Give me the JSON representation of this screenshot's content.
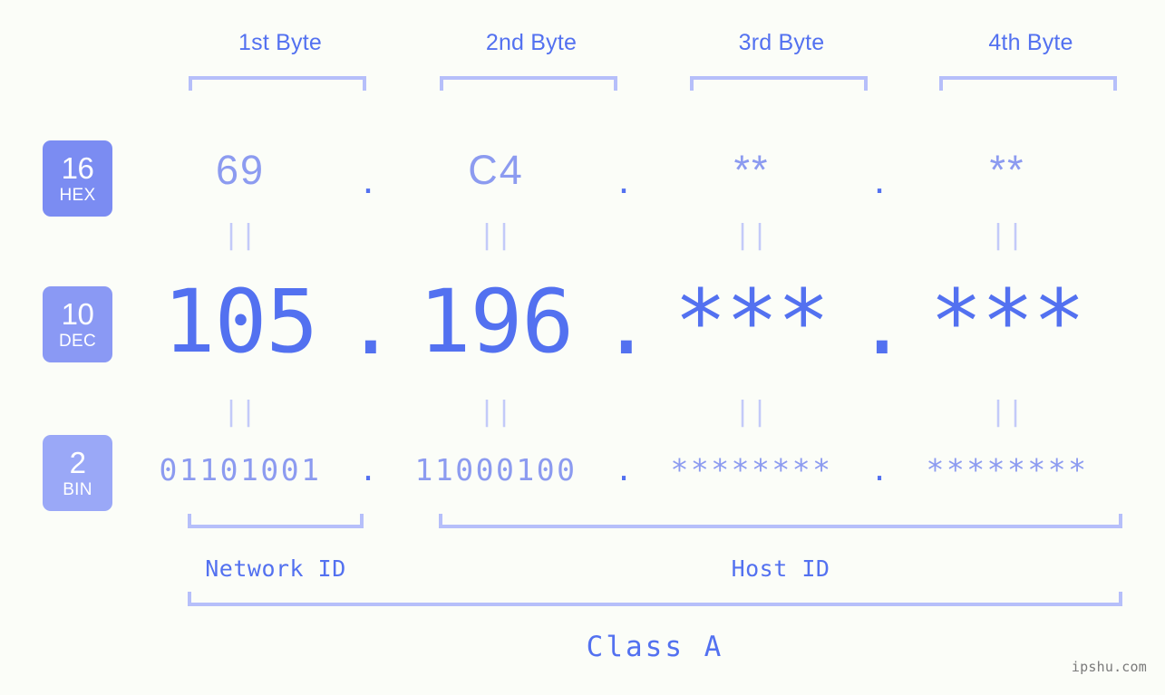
{
  "background_color": "#fbfdf8",
  "accent": {
    "strong_blue": "#5371f0",
    "mid_blue": "#8c9bf0",
    "light_blue": "#b6bffa",
    "pale_blue": "#c3caf9",
    "badge_hex": "#7b8cf2",
    "badge_dec": "#8a99f4",
    "badge_bin": "#9aa8f7",
    "watermark_gray": "#7a7a7a"
  },
  "byte_headers": [
    {
      "label": "1st Byte"
    },
    {
      "label": "2nd Byte"
    },
    {
      "label": "3rd Byte"
    },
    {
      "label": "4th Byte"
    }
  ],
  "bases": [
    {
      "number": "16",
      "name": "HEX"
    },
    {
      "number": "10",
      "name": "DEC"
    },
    {
      "number": "2",
      "name": "BIN"
    }
  ],
  "separator": ".",
  "equals_glyph": "||",
  "rows": {
    "hex": {
      "base_number": "16",
      "base_name": "HEX",
      "values": [
        "69",
        "C4",
        "**",
        "**"
      ]
    },
    "dec": {
      "base_number": "10",
      "base_name": "DEC",
      "values": [
        "105",
        "196",
        "***",
        "***"
      ]
    },
    "bin": {
      "base_number": "2",
      "base_name": "BIN",
      "values": [
        "01101001",
        "11000100",
        "********",
        "********"
      ]
    }
  },
  "id_sections": {
    "network": {
      "label": "Network ID"
    },
    "host": {
      "label": "Host ID"
    }
  },
  "class": {
    "label": "Class A"
  },
  "watermark": {
    "text": "ipshu.com"
  }
}
